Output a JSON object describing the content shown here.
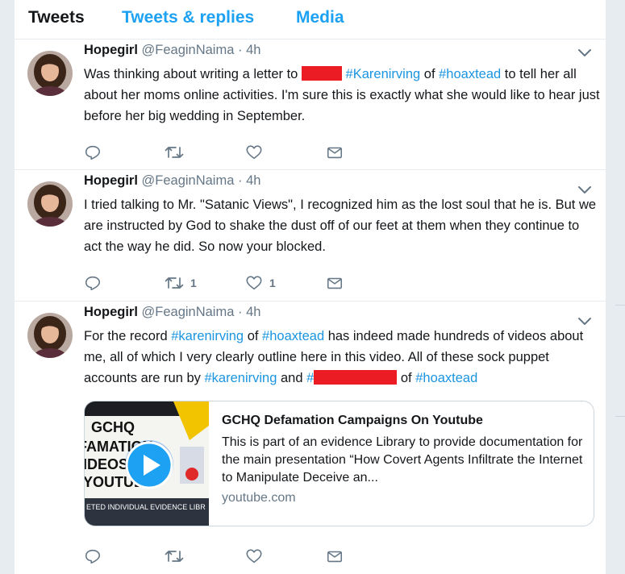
{
  "tabs": [
    "Tweets",
    "Tweets & replies",
    "Media"
  ],
  "tweets": [
    {
      "name": "Hopegirl",
      "handle": "@FeaginNaima",
      "dot": "·",
      "time": "4h",
      "text": {
        "p1": "Was thinking about writing a letter to ",
        "h1": "#Karenirving",
        "p2": " of ",
        "h2": "#hoaxtead",
        "p3": " to tell her all about her moms online activities. I'm sure this is exactly what she would like to hear just before her big wedding in September."
      },
      "retweets": "",
      "likes": ""
    },
    {
      "name": "Hopegirl",
      "handle": "@FeaginNaima",
      "dot": "·",
      "time": "4h",
      "text": "I tried talking to Mr. \"Satanic Views\", I recognized him as the lost soul that he is. But we are instructed by God to shake the dust off of our feet at them when they continue to act the way he did. So now your blocked.",
      "retweets": "1",
      "likes": "1"
    },
    {
      "name": "Hopegirl",
      "handle": "@FeaginNaima",
      "dot": "·",
      "time": "4h",
      "text": {
        "p1": "For the record ",
        "h1": "#karenirving",
        "p2": " of ",
        "h2": "#hoaxtead",
        "p3": " has indeed made hundreds of videos about me, all of which I very clearly outline here in this video. All of these sock puppet accounts are run by ",
        "h3": "#karenirving",
        "p4": " and ",
        "h4": "#",
        "p5": " of ",
        "h5": "#hoaxtead"
      },
      "card": {
        "title": "GCHQ Defamation Campaigns On Youtube",
        "description": "This is part of an evidence Library to provide documentation for the main presentation “How Covert Agents Infiltrate the Internet to Manipulate Deceive an...",
        "domain": "youtube.com",
        "thumb_lines": [
          "GCHQ",
          "FAMATION",
          "IDEOS ON",
          "YOUTUBE"
        ],
        "thumb_footer": "ETED INDIVIDUAL EVIDENCE LIBR"
      },
      "retweets": "",
      "likes": ""
    }
  ],
  "colors": {
    "link": "#1b95e0",
    "tab_active": "#14171a",
    "tab": "#1da1f2",
    "muted": "#657786",
    "redaction": "#ec1c24"
  },
  "icons": [
    "reply-icon",
    "retweet-icon",
    "like-icon",
    "message-icon",
    "chevron-down-icon",
    "play-icon"
  ]
}
